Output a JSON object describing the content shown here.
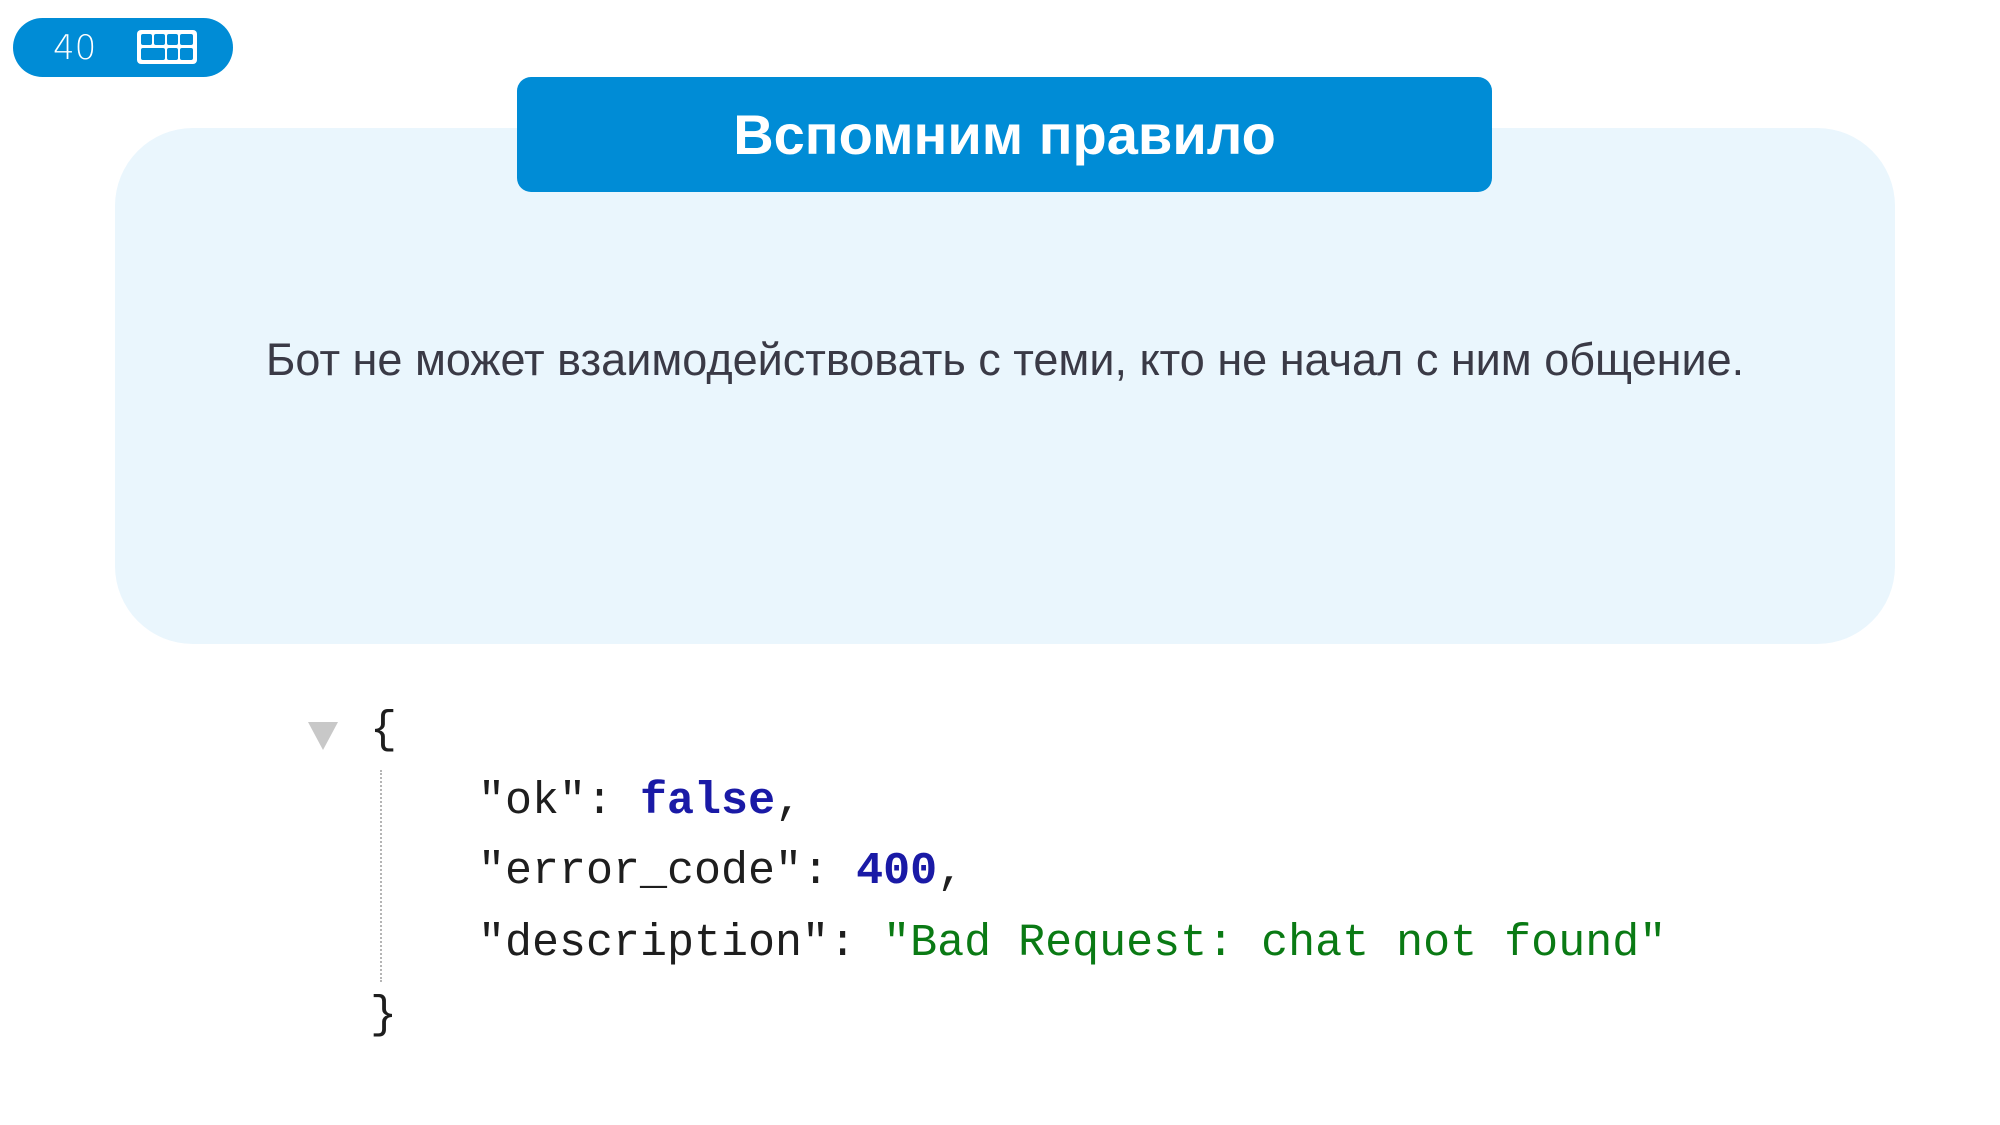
{
  "badge": {
    "slide_number": "40",
    "icon": "keyboard-icon"
  },
  "title": "Вспомним правило",
  "rule_text": "Бот не может взаимодействовать с теми, кто не начал с ним общение.",
  "code": {
    "open_brace": "{",
    "close_brace": "}",
    "lines": [
      {
        "key": "\"ok\"",
        "sep": ": ",
        "value": "false",
        "tail": ","
      },
      {
        "key": "\"error_code\"",
        "sep": ": ",
        "value": "400",
        "tail": ","
      },
      {
        "key": "\"description\"",
        "sep": ": ",
        "value": "\"Bad Request: chat not found\"",
        "tail": ""
      }
    ]
  },
  "colors": {
    "accent": "#008cd6",
    "panel": "#eaf6fd",
    "keyword": "#1a1aa6",
    "string": "#0a7a14"
  }
}
